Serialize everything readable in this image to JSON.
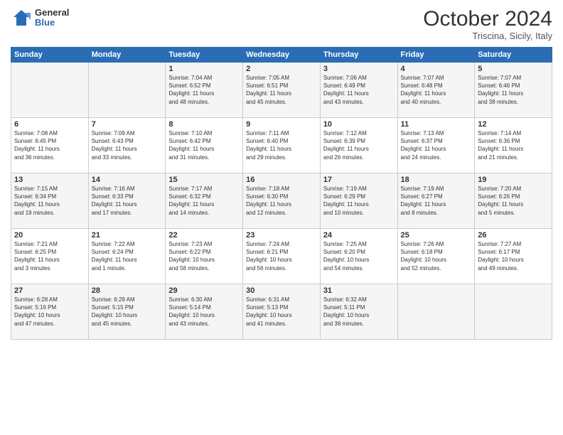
{
  "header": {
    "logo_general": "General",
    "logo_blue": "Blue",
    "month": "October 2024",
    "location": "Triscina, Sicily, Italy"
  },
  "weekdays": [
    "Sunday",
    "Monday",
    "Tuesday",
    "Wednesday",
    "Thursday",
    "Friday",
    "Saturday"
  ],
  "weeks": [
    [
      {
        "day": "",
        "info": ""
      },
      {
        "day": "",
        "info": ""
      },
      {
        "day": "1",
        "info": "Sunrise: 7:04 AM\nSunset: 6:52 PM\nDaylight: 11 hours\nand 48 minutes."
      },
      {
        "day": "2",
        "info": "Sunrise: 7:05 AM\nSunset: 6:51 PM\nDaylight: 11 hours\nand 45 minutes."
      },
      {
        "day": "3",
        "info": "Sunrise: 7:06 AM\nSunset: 6:49 PM\nDaylight: 11 hours\nand 43 minutes."
      },
      {
        "day": "4",
        "info": "Sunrise: 7:07 AM\nSunset: 6:48 PM\nDaylight: 11 hours\nand 40 minutes."
      },
      {
        "day": "5",
        "info": "Sunrise: 7:07 AM\nSunset: 6:46 PM\nDaylight: 11 hours\nand 38 minutes."
      }
    ],
    [
      {
        "day": "6",
        "info": "Sunrise: 7:08 AM\nSunset: 6:45 PM\nDaylight: 11 hours\nand 36 minutes."
      },
      {
        "day": "7",
        "info": "Sunrise: 7:09 AM\nSunset: 6:43 PM\nDaylight: 11 hours\nand 33 minutes."
      },
      {
        "day": "8",
        "info": "Sunrise: 7:10 AM\nSunset: 6:42 PM\nDaylight: 11 hours\nand 31 minutes."
      },
      {
        "day": "9",
        "info": "Sunrise: 7:11 AM\nSunset: 6:40 PM\nDaylight: 11 hours\nand 29 minutes."
      },
      {
        "day": "10",
        "info": "Sunrise: 7:12 AM\nSunset: 6:39 PM\nDaylight: 11 hours\nand 26 minutes."
      },
      {
        "day": "11",
        "info": "Sunrise: 7:13 AM\nSunset: 6:37 PM\nDaylight: 11 hours\nand 24 minutes."
      },
      {
        "day": "12",
        "info": "Sunrise: 7:14 AM\nSunset: 6:36 PM\nDaylight: 11 hours\nand 21 minutes."
      }
    ],
    [
      {
        "day": "13",
        "info": "Sunrise: 7:15 AM\nSunset: 6:34 PM\nDaylight: 11 hours\nand 19 minutes."
      },
      {
        "day": "14",
        "info": "Sunrise: 7:16 AM\nSunset: 6:33 PM\nDaylight: 11 hours\nand 17 minutes."
      },
      {
        "day": "15",
        "info": "Sunrise: 7:17 AM\nSunset: 6:32 PM\nDaylight: 11 hours\nand 14 minutes."
      },
      {
        "day": "16",
        "info": "Sunrise: 7:18 AM\nSunset: 6:30 PM\nDaylight: 11 hours\nand 12 minutes."
      },
      {
        "day": "17",
        "info": "Sunrise: 7:19 AM\nSunset: 6:29 PM\nDaylight: 11 hours\nand 10 minutes."
      },
      {
        "day": "18",
        "info": "Sunrise: 7:19 AM\nSunset: 6:27 PM\nDaylight: 11 hours\nand 8 minutes."
      },
      {
        "day": "19",
        "info": "Sunrise: 7:20 AM\nSunset: 6:26 PM\nDaylight: 11 hours\nand 5 minutes."
      }
    ],
    [
      {
        "day": "20",
        "info": "Sunrise: 7:21 AM\nSunset: 6:25 PM\nDaylight: 11 hours\nand 3 minutes."
      },
      {
        "day": "21",
        "info": "Sunrise: 7:22 AM\nSunset: 6:24 PM\nDaylight: 11 hours\nand 1 minute."
      },
      {
        "day": "22",
        "info": "Sunrise: 7:23 AM\nSunset: 6:22 PM\nDaylight: 10 hours\nand 58 minutes."
      },
      {
        "day": "23",
        "info": "Sunrise: 7:24 AM\nSunset: 6:21 PM\nDaylight: 10 hours\nand 56 minutes."
      },
      {
        "day": "24",
        "info": "Sunrise: 7:25 AM\nSunset: 6:20 PM\nDaylight: 10 hours\nand 54 minutes."
      },
      {
        "day": "25",
        "info": "Sunrise: 7:26 AM\nSunset: 6:18 PM\nDaylight: 10 hours\nand 52 minutes."
      },
      {
        "day": "26",
        "info": "Sunrise: 7:27 AM\nSunset: 6:17 PM\nDaylight: 10 hours\nand 49 minutes."
      }
    ],
    [
      {
        "day": "27",
        "info": "Sunrise: 6:28 AM\nSunset: 5:16 PM\nDaylight: 10 hours\nand 47 minutes."
      },
      {
        "day": "28",
        "info": "Sunrise: 6:29 AM\nSunset: 5:15 PM\nDaylight: 10 hours\nand 45 minutes."
      },
      {
        "day": "29",
        "info": "Sunrise: 6:30 AM\nSunset: 5:14 PM\nDaylight: 10 hours\nand 43 minutes."
      },
      {
        "day": "30",
        "info": "Sunrise: 6:31 AM\nSunset: 5:13 PM\nDaylight: 10 hours\nand 41 minutes."
      },
      {
        "day": "31",
        "info": "Sunrise: 6:32 AM\nSunset: 5:11 PM\nDaylight: 10 hours\nand 39 minutes."
      },
      {
        "day": "",
        "info": ""
      },
      {
        "day": "",
        "info": ""
      }
    ]
  ]
}
